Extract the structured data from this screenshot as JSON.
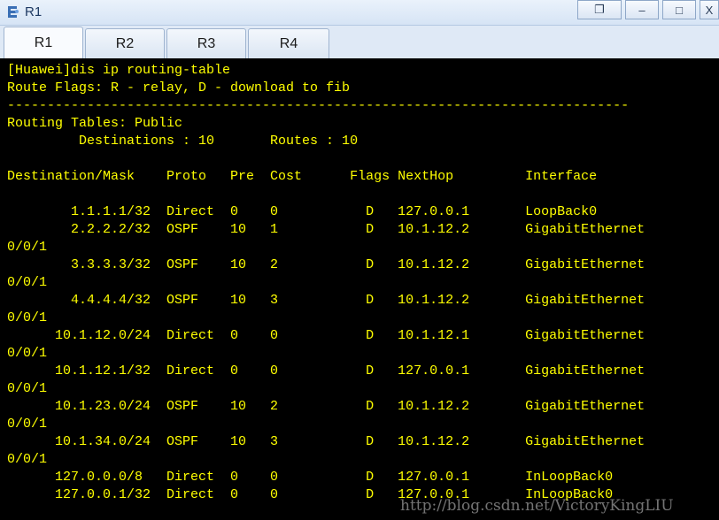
{
  "window": {
    "title": "R1",
    "restore_glyph": "❐",
    "minimize_glyph": "–",
    "maximize_glyph": "□",
    "close_glyph": "X"
  },
  "tabs": [
    {
      "label": "R1",
      "active": true
    },
    {
      "label": "R2",
      "active": false
    },
    {
      "label": "R3",
      "active": false
    },
    {
      "label": "R4",
      "active": false
    }
  ],
  "terminal": {
    "text_color": "#ffff00",
    "background": "#000000",
    "lines": [
      "[Huawei]dis ip routing-table",
      "Route Flags: R - relay, D - download to fib",
      "------------------------------------------------------------------------------",
      "Routing Tables: Public",
      "         Destinations : 10       Routes : 10",
      "",
      "Destination/Mask    Proto   Pre  Cost      Flags NextHop         Interface",
      "",
      "        1.1.1.1/32  Direct  0    0           D   127.0.0.1       LoopBack0",
      "        2.2.2.2/32  OSPF    10   1           D   10.1.12.2       GigabitEthernet",
      "0/0/1",
      "        3.3.3.3/32  OSPF    10   2           D   10.1.12.2       GigabitEthernet",
      "0/0/1",
      "        4.4.4.4/32  OSPF    10   3           D   10.1.12.2       GigabitEthernet",
      "0/0/1",
      "      10.1.12.0/24  Direct  0    0           D   10.1.12.1       GigabitEthernet",
      "0/0/1",
      "      10.1.12.1/32  Direct  0    0           D   127.0.0.1       GigabitEthernet",
      "0/0/1",
      "      10.1.23.0/24  OSPF    10   2           D   10.1.12.2       GigabitEthernet",
      "0/0/1",
      "      10.1.34.0/24  OSPF    10   3           D   10.1.12.2       GigabitEthernet",
      "0/0/1",
      "      127.0.0.0/8   Direct  0    0           D   127.0.0.1       InLoopBack0",
      "      127.0.0.1/32  Direct  0    0           D   127.0.0.1       InLoopBack0"
    ]
  },
  "watermark": "http://blog.csdn.net/VictoryKingLIU"
}
